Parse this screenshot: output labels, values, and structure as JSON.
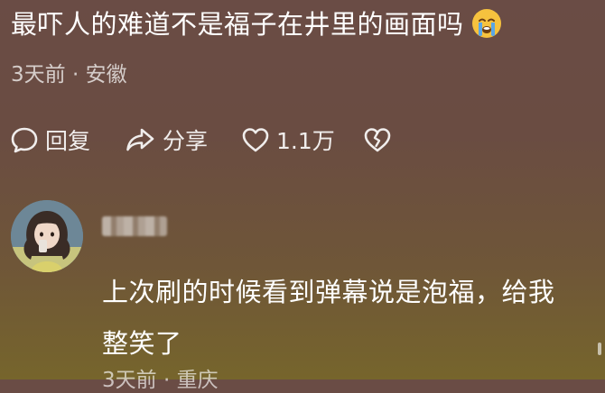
{
  "comment_1": {
    "text": "最吓人的难道不是福子在井里的画面吗",
    "emoji": "crying-face-icon",
    "meta": "3天前 · 安徽"
  },
  "actions": {
    "reply_label": "回复",
    "share_label": "分享",
    "like_count": "1.1万"
  },
  "comment_2": {
    "text": "上次刷的时候看到弹幕说是泡福，给我整笑了",
    "meta": "3天前 · 重庆"
  },
  "colors": {
    "background_top": "#6a4c45",
    "background_bottom": "#76652c",
    "text": "#ffffff",
    "emoji": "#f6c23e",
    "tear": "#5aa6e6"
  }
}
